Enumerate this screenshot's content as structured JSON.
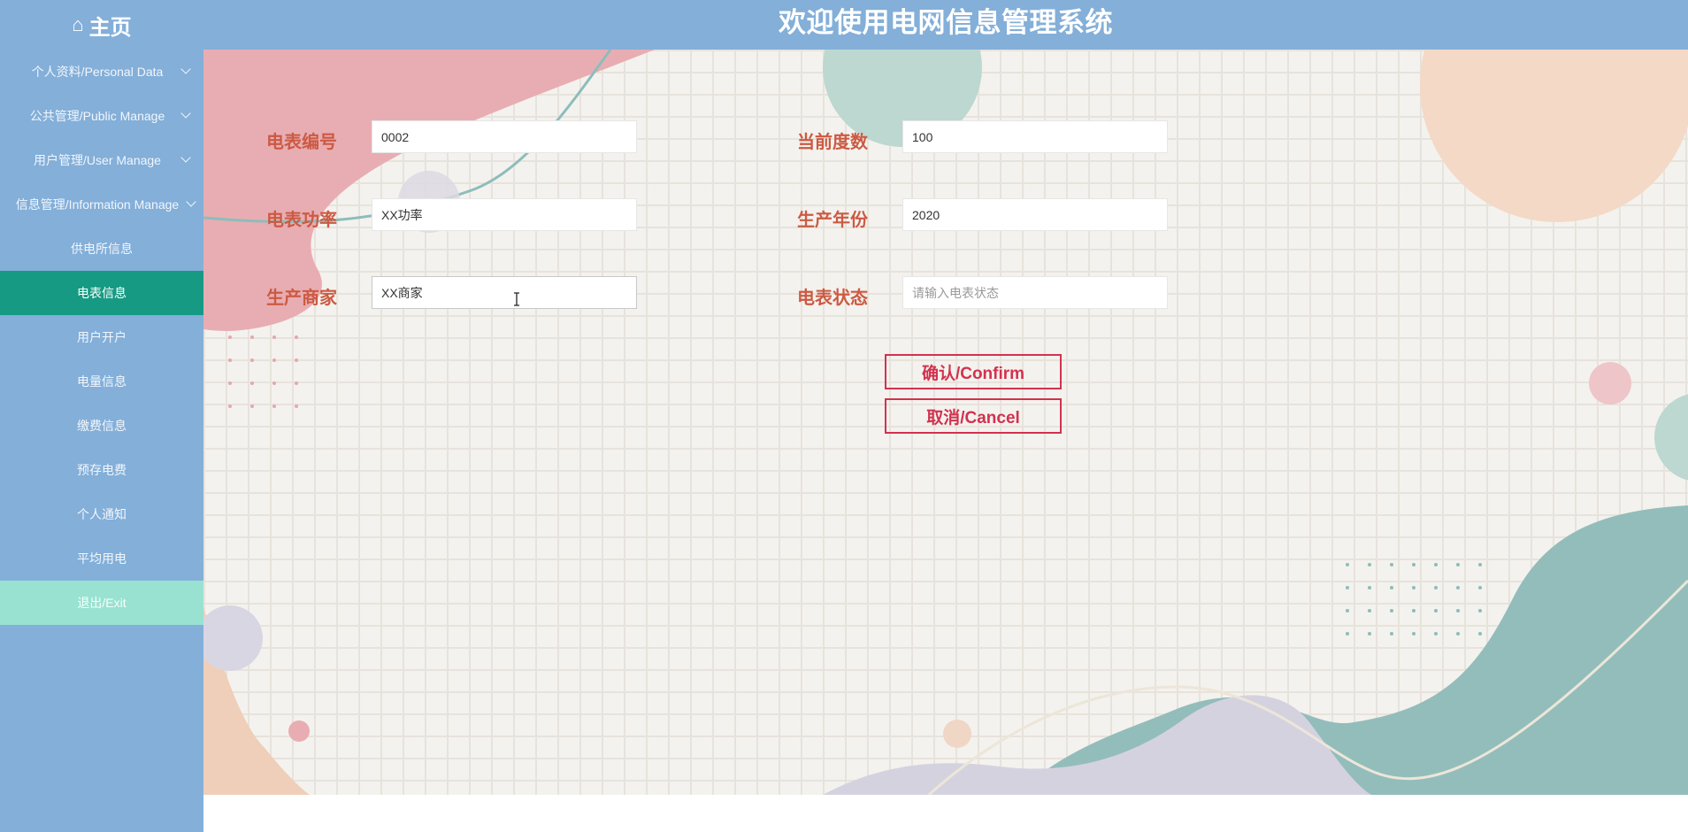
{
  "header": {
    "home_icon": "home-icon",
    "home_label": "主页",
    "title": "欢迎使用电网信息管理系统"
  },
  "sidebar": {
    "groups": [
      {
        "label": "个人资料/Personal Data"
      },
      {
        "label": "公共管理/Public Manage"
      },
      {
        "label": "用户管理/User Manage"
      },
      {
        "label": "信息管理/Information Manage"
      }
    ],
    "items": [
      {
        "label": "供电所信息"
      },
      {
        "label": "电表信息",
        "active": true
      },
      {
        "label": "用户开户"
      },
      {
        "label": "电量信息"
      },
      {
        "label": "缴费信息"
      },
      {
        "label": "预存电费"
      },
      {
        "label": "个人通知"
      },
      {
        "label": "平均用电"
      }
    ],
    "exit_label": "退出/Exit"
  },
  "form": {
    "meter_no": {
      "label": "电表编号",
      "value": "0002"
    },
    "current_reading": {
      "label": "当前度数",
      "value": "100"
    },
    "meter_power": {
      "label": "电表功率",
      "value": "XX功率"
    },
    "production_year": {
      "label": "生产年份",
      "value": "2020"
    },
    "manufacturer": {
      "label": "生产商家",
      "value": "XX商家"
    },
    "meter_status": {
      "label": "电表状态",
      "value": "",
      "placeholder": "请输入电表状态"
    }
  },
  "buttons": {
    "confirm": "确认/Confirm",
    "cancel": "取消/Cancel"
  },
  "colors": {
    "header_bg": "#83afd9",
    "active_item": "#169a83",
    "exit_item": "#99e2d2",
    "label_text": "#cc5a43",
    "button_accent": "#d2324f"
  }
}
